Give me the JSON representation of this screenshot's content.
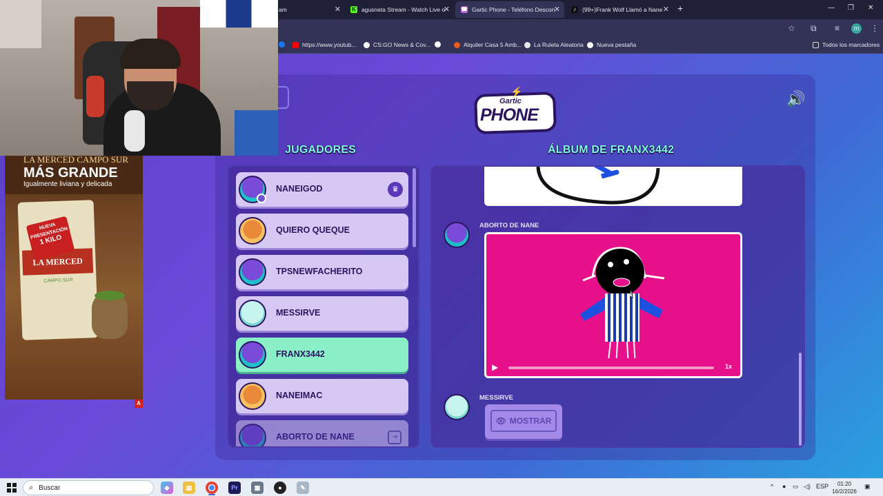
{
  "browser": {
    "tabs": [
      {
        "label": "am",
        "fav_color": "#1f1f38",
        "fav_text": ""
      },
      {
        "label": "agusneta Stream - Watch Live o",
        "fav_color": "#53fc18",
        "fav_text": "K"
      },
      {
        "label": "Gartic Phone - Teléfono Descon",
        "fav_color": "#c05ad8",
        "fav_text": "☎"
      },
      {
        "label": "(99+)Frank Wolf Llamó a Nane",
        "fav_color": "#111111",
        "fav_text": "♪"
      }
    ],
    "active_tab_index": 2,
    "new_tab": "+",
    "window_controls": {
      "minimize": "—",
      "restore": "❐",
      "close": "✕"
    },
    "profile_initial": "m",
    "bookmarks": [
      {
        "label": "https://www.youtub...",
        "color": "#ff0000"
      },
      {
        "label": "CS:GO News & Cov...",
        "color": "#ffffff"
      },
      {
        "label": "",
        "color": "#ffffff"
      },
      {
        "label": "Alquiler Casa 5 Amb...",
        "color": "#e85a20"
      },
      {
        "label": "La Ruleta Aleatoria",
        "color": "#e8e8e8"
      },
      {
        "label": "Nueva pestaña",
        "color": "#ffffff"
      }
    ],
    "all_bookmarks": "Todos los marcadores"
  },
  "game": {
    "logo_small": "Gartic",
    "logo_big": "PHONE",
    "players_title": "JUGADORES",
    "album_title": "ÁLBUM DE FRANX3442",
    "players": [
      {
        "name": "NANEIGOD",
        "avatar": "purple",
        "host": true
      },
      {
        "name": "QUIERO QUEQUE",
        "avatar": "burger"
      },
      {
        "name": "TPSNEWFACHERITO",
        "avatar": "purple"
      },
      {
        "name": "MESSIRVE",
        "avatar": "ghost"
      },
      {
        "name": "FRANX3442",
        "avatar": "purple",
        "active": true
      },
      {
        "name": "NANEIMAC",
        "avatar": "burger"
      },
      {
        "name": "ABORTO DE NANE",
        "avatar": "purple",
        "faded": true
      }
    ],
    "album": {
      "entry1_author": "ABORTO DE NANE",
      "entry2_author": "MESSIRVE",
      "speed_label": "1x",
      "show_button": "MOSTRAR"
    }
  },
  "ad": {
    "line1": "LA MERCED CAMPO SUR",
    "line2": "MÁS GRANDE",
    "line3": "Igualmente liviana y delicada",
    "badge": "NUEVA PRESENTACIÓN",
    "badge_kilo": "1 KILO",
    "pack_brand": "LA MERCED",
    "pack_sub": "CAMPO SUR",
    "corner": "A"
  },
  "taskbar": {
    "search_placeholder": "Buscar",
    "lang": "ESP",
    "time": "01:20",
    "date": "16/2/2026"
  }
}
